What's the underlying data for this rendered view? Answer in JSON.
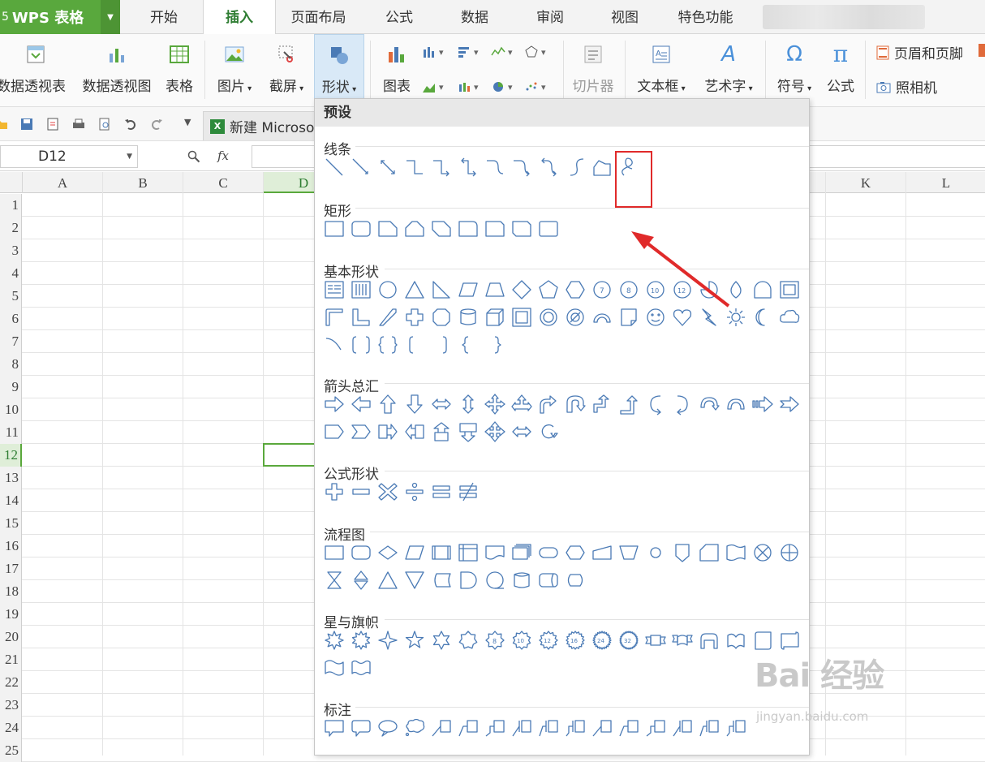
{
  "app": {
    "name": "WPS 表格",
    "prefix": "5"
  },
  "tabs": [
    "开始",
    "插入",
    "页面布局",
    "公式",
    "数据",
    "审阅",
    "视图",
    "特色功能"
  ],
  "active_tab": "插入",
  "ribbon": {
    "pivot_table": "数据透视表",
    "pivot_chart": "数据透视图",
    "table": "表格",
    "picture": "图片",
    "screenshot": "截屏",
    "shapes": "形状",
    "chart": "图表",
    "slicer": "切片器",
    "textbox": "文本框",
    "wordart": "艺术字",
    "symbol": "符号",
    "formula": "公式",
    "header_footer": "页眉和页脚",
    "camera": "照相机",
    "shapes_symbol": "Ω",
    "formula_symbol": "π",
    "wordart_symbol": "A"
  },
  "doc_tab": {
    "label": "新建 Microsoft"
  },
  "formula_bar": {
    "cell_ref": "D12",
    "fx": "fx",
    "value": ""
  },
  "columns": [
    "A",
    "B",
    "C",
    "D",
    "K",
    "L"
  ],
  "active_column": "D",
  "rows": [
    "1",
    "2",
    "3",
    "4",
    "5",
    "6",
    "7",
    "8",
    "9",
    "10",
    "11",
    "12",
    "13",
    "14",
    "15",
    "16",
    "17",
    "18",
    "19",
    "20",
    "21",
    "22",
    "23",
    "24",
    "25"
  ],
  "active_row": "12",
  "shapes_menu": {
    "header": "预设",
    "sections": [
      {
        "title": "线条",
        "rows": [
          12
        ]
      },
      {
        "title": "矩形",
        "rows": [
          9
        ]
      },
      {
        "title": "基本形状",
        "rows": [
          18,
          18,
          7
        ]
      },
      {
        "title": "箭头总汇",
        "rows": [
          18,
          9
        ]
      },
      {
        "title": "公式形状",
        "rows": [
          6
        ]
      },
      {
        "title": "流程图",
        "rows": [
          18,
          10
        ]
      },
      {
        "title": "星与旗帜",
        "rows": [
          18,
          2
        ]
      },
      {
        "title": "标注",
        "rows": [
          16
        ]
      }
    ]
  },
  "highlight": {
    "note": "freeform scribble shape",
    "color": "#e02a2a"
  },
  "watermark": {
    "logo": "Bai 经验",
    "url": "jingyan.baidu.com"
  },
  "colors": {
    "accent_green": "#59a83d",
    "shape_stroke": "#4a7ab5",
    "selection": "#5aa83c"
  }
}
